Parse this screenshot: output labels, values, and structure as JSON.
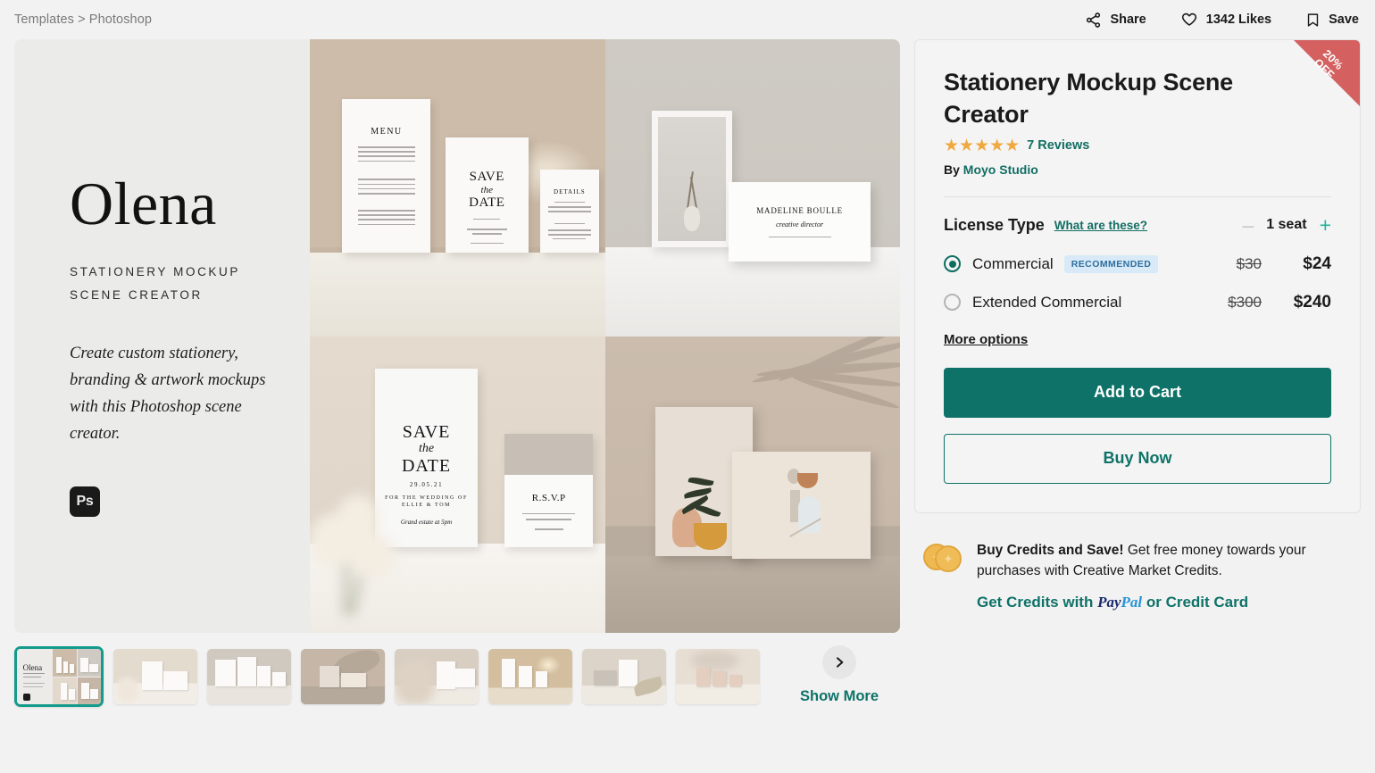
{
  "breadcrumb": "Templates > Photoshop",
  "topbar": {
    "share_label": "Share",
    "likes_label": "1342 Likes",
    "save_label": "Save"
  },
  "hero": {
    "brand": "Olena",
    "subtitle_line1": "STATIONERY MOCKUP",
    "subtitle_line2": "SCENE CREATOR",
    "description": "Create custom stationery, branding & artwork mockups with this Photoshop scene creator.",
    "app_badge": "Ps"
  },
  "gallery": {
    "images": [
      {
        "name": "menu-save-the-date-details-set",
        "caption": "MENU / SAVE the DATE / DETAILS"
      },
      {
        "name": "frame-and-business-card",
        "caption": "MADELINE BOULLE creative director"
      },
      {
        "name": "save-the-date-with-envelope",
        "caption": "SAVE the DATE / R.S.V.P"
      },
      {
        "name": "art-prints-palm-shadow",
        "caption": "Abstract art prints"
      }
    ],
    "card_texts": {
      "menu": "MENU",
      "save": "SAVE",
      "the": "the",
      "date": "DATE",
      "details": "DETAILS",
      "bc_name": "MADELINE BOULLE",
      "bc_role": "creative director",
      "std_date": "29.05.21",
      "std_line1": "FOR THE WEDDING OF",
      "std_line2": "ELLIE & TOM",
      "std_sub": "Grand estate at 5pm",
      "rsvp": "R.S.V.P"
    }
  },
  "product": {
    "title": "Stationery Mockup Scene Creator",
    "stars": "★★★★★",
    "star_count": 5,
    "reviews_label": "7 Reviews",
    "by_prefix": "By",
    "author": "Moyo Studio",
    "discount_badge_line1": "20%",
    "discount_badge_line2": "OFF",
    "colors": {
      "accent_teal": "#0E7268",
      "star_amber": "#F0A840",
      "badge_red": "#D46060",
      "recommended_blue": "#2E6E9E"
    }
  },
  "license": {
    "label": "License Type",
    "help_link": "What are these?",
    "quantity": "1 seat",
    "decrement": "–",
    "increment": "+",
    "options": [
      {
        "name": "Commercial",
        "badge": "RECOMMENDED",
        "price_original": "$30",
        "price_current": "$24",
        "selected": true
      },
      {
        "name": "Extended Commercial",
        "badge": "",
        "price_original": "$300",
        "price_current": "$240",
        "selected": false
      }
    ],
    "more_options": "More options"
  },
  "actions": {
    "add_to_cart": "Add to Cart",
    "buy_now": "Buy Now"
  },
  "credits": {
    "headline": "Buy Credits and Save!",
    "body": " Get free money towards your purchases with Creative Market Credits.",
    "link_prefix": "Get Credits with ",
    "paypal_pay": "Pay",
    "paypal_pal": "Pal",
    "link_suffix": " or Credit Card"
  },
  "thumbnails": {
    "items": [
      {
        "name": "thumb-cover-olena",
        "selected": true
      },
      {
        "name": "thumb-flowers-cards",
        "selected": false
      },
      {
        "name": "thumb-frames-set",
        "selected": false
      },
      {
        "name": "thumb-palm-shadow-prints",
        "selected": false
      },
      {
        "name": "thumb-dried-flower-cards",
        "selected": false
      },
      {
        "name": "thumb-warm-candle-cards",
        "selected": false
      },
      {
        "name": "thumb-leaf-invites",
        "selected": false
      },
      {
        "name": "thumb-blush-trio",
        "selected": false
      }
    ],
    "show_more_label": "Show More"
  }
}
